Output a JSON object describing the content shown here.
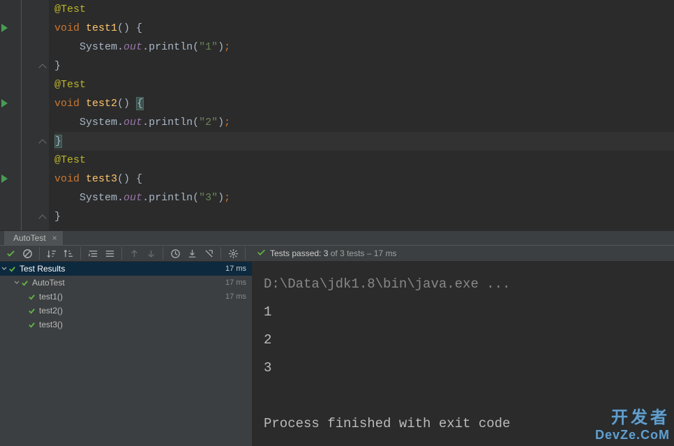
{
  "code": {
    "anno1": "@Test",
    "kw_void": "void",
    "fn1": "test1",
    "fn2": "test2",
    "fn3": "test3",
    "sys": "System",
    "out": "out",
    "println": "println",
    "str1": "\"1\"",
    "str2": "\"2\"",
    "str3": "\"3\""
  },
  "runnerTab": {
    "label": "AutoTest"
  },
  "passMsg": {
    "prefix": "Tests passed: 3",
    "suffix": " of 3 tests – 17 ms"
  },
  "tree": {
    "root": {
      "label": "Test Results",
      "time": "17 ms"
    },
    "suite": {
      "label": "AutoTest",
      "time": "17 ms"
    },
    "items": [
      {
        "label": "test1()",
        "time": "17 ms"
      },
      {
        "label": "test2()",
        "time": ""
      },
      {
        "label": "test3()",
        "time": ""
      }
    ]
  },
  "console": {
    "cmd": "D:\\Data\\jdk1.8\\bin\\java.exe ...",
    "lines": [
      "1",
      "2",
      "3"
    ],
    "footer": "Process finished with exit code "
  },
  "watermark": {
    "cn": "开发者",
    "en": "DevZe.CoM"
  }
}
